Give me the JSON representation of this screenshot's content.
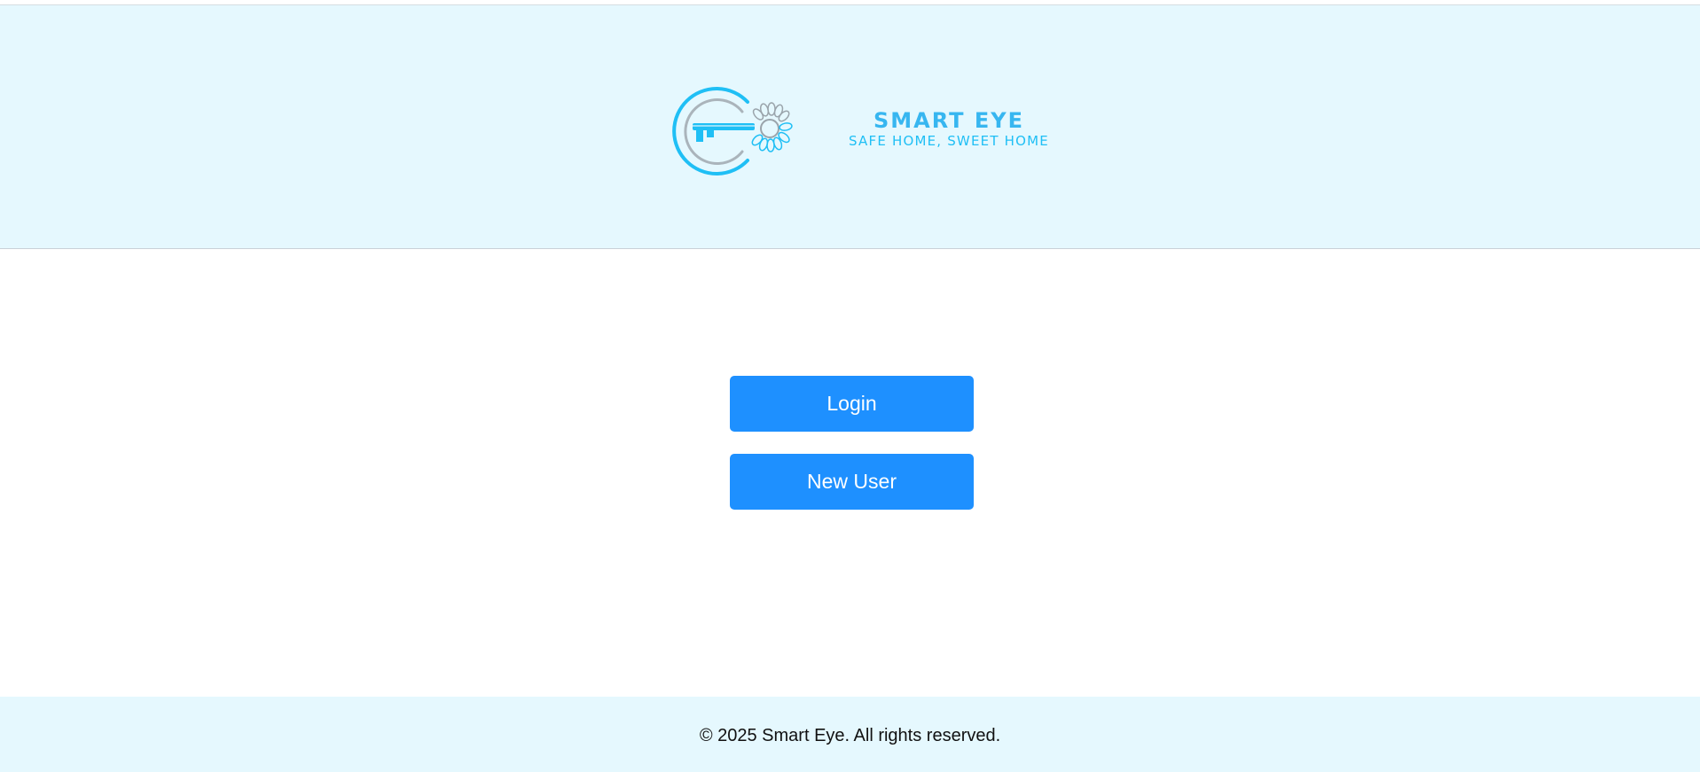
{
  "header": {
    "brand_name": "SMART EYE",
    "tagline": "SAFE HOME, SWEET HOME",
    "logo_icon": "key-eye-logo-icon"
  },
  "actions": {
    "login_label": "Login",
    "new_user_label": "New User"
  },
  "footer": {
    "copyright": "© 2025 Smart Eye. All rights reserved."
  },
  "colors": {
    "header_bg": "#e5f8fe",
    "brand_blue": "#29b8f4",
    "button_bg": "#1e90ff",
    "button_text": "#ffffff"
  }
}
